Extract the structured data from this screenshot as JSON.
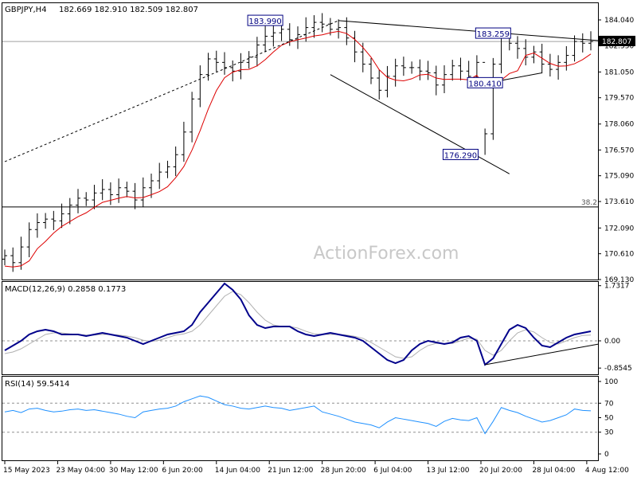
{
  "chart_data": [
    {
      "type": "candlestick",
      "panel": "price",
      "header": {
        "symbol": "GBPJPY,H4",
        "ohlc": "182.669 182.910 182.509 182.807"
      },
      "ylim": [
        169.13,
        185.0
      ],
      "y_ticks": [
        184.04,
        182.55,
        181.05,
        179.57,
        178.06,
        176.57,
        175.09,
        173.61,
        172.09,
        170.61,
        169.13
      ],
      "y_tick_labels": [
        "184.040",
        "182.550",
        "181.050",
        "179.570",
        "178.060",
        "176.570",
        "175.090",
        "173.610",
        "172.090",
        "170.610",
        "169.130"
      ],
      "current_price": {
        "value": 182.807,
        "label": "182.807"
      },
      "fib_level": {
        "value": 173.3,
        "label": "38.2"
      },
      "reference_line": 182.8,
      "annotations": [
        {
          "label": "183.990",
          "x": 32,
          "y": 183.99
        },
        {
          "label": "183.259",
          "x": 60,
          "y": 183.259
        },
        {
          "label": "180.410",
          "x": 59,
          "y": 180.41
        },
        {
          "label": "176.290",
          "x": 56,
          "y": 176.29
        }
      ],
      "trendlines": [
        {
          "x1": 0,
          "y1": 175.9,
          "x2": 41,
          "y2": 184.0,
          "style": "dashed"
        },
        {
          "x1": 41,
          "y1": 184.0,
          "x2": 73,
          "y2": 182.85,
          "style": "solid"
        },
        {
          "x1": 40,
          "y1": 180.9,
          "x2": 62,
          "y2": 175.2,
          "style": "solid"
        },
        {
          "x1": 58,
          "y1": 180.3,
          "x2": 66,
          "y2": 181.0,
          "style": "solid"
        }
      ],
      "ma_color": "#dd0000",
      "bar_color": "#000000",
      "watermark": "ActionForex.com",
      "closes": [
        170.5,
        170.1,
        171.0,
        172.0,
        172.4,
        172.6,
        172.5,
        172.9,
        173.4,
        173.8,
        173.7,
        174.1,
        174.3,
        174.0,
        174.4,
        174.2,
        173.7,
        174.4,
        174.8,
        175.3,
        175.6,
        176.3,
        177.6,
        179.5,
        180.9,
        181.8,
        181.6,
        181.3,
        181.1,
        181.6,
        181.9,
        182.6,
        183.1,
        183.3,
        183.5,
        182.9,
        183.2,
        183.6,
        183.9,
        183.8,
        183.5,
        183.6,
        183.0,
        182.2,
        181.5,
        180.7,
        180.0,
        180.8,
        181.4,
        181.3,
        181.3,
        181.1,
        181.0,
        180.3,
        180.9,
        181.4,
        181.1,
        180.8,
        181.6,
        177.5,
        181.5,
        183.0,
        182.7,
        182.4,
        181.9,
        182.2,
        181.5,
        181.2,
        181.6,
        182.0,
        182.8,
        182.7,
        182.8
      ]
    },
    {
      "type": "line",
      "panel": "macd",
      "header": "MACD(12,26,9) 0.2858 0.1773",
      "ylim": [
        -1.05,
        1.85
      ],
      "y_tick_labels": [
        "1.7317",
        "0.00",
        "-0.8545"
      ],
      "y_ticks": [
        1.7317,
        0.0,
        -0.8545
      ],
      "current_value": {
        "value": 0.0,
        "label": "0.00"
      },
      "main_color": "#00008b",
      "signal_color": "#b0b0b0",
      "main": [
        -0.3,
        -0.15,
        0.0,
        0.2,
        0.3,
        0.35,
        0.3,
        0.2,
        0.2,
        0.2,
        0.15,
        0.2,
        0.25,
        0.2,
        0.15,
        0.1,
        0.0,
        -0.1,
        0.0,
        0.1,
        0.2,
        0.25,
        0.3,
        0.5,
        0.9,
        1.2,
        1.5,
        1.8,
        1.6,
        1.3,
        0.8,
        0.5,
        0.4,
        0.45,
        0.45,
        0.45,
        0.3,
        0.2,
        0.15,
        0.2,
        0.25,
        0.2,
        0.15,
        0.1,
        0.0,
        -0.2,
        -0.4,
        -0.6,
        -0.7,
        -0.6,
        -0.3,
        -0.1,
        0.0,
        -0.05,
        -0.1,
        -0.05,
        0.1,
        0.15,
        0.0,
        -0.75,
        -0.55,
        -0.1,
        0.35,
        0.5,
        0.4,
        0.1,
        -0.15,
        -0.2,
        -0.05,
        0.1,
        0.2,
        0.25,
        0.3
      ],
      "signal": [
        -0.4,
        -0.35,
        -0.25,
        -0.1,
        0.05,
        0.2,
        0.25,
        0.25,
        0.22,
        0.2,
        0.18,
        0.18,
        0.2,
        0.2,
        0.18,
        0.15,
        0.1,
        0.02,
        -0.02,
        0.02,
        0.1,
        0.18,
        0.22,
        0.3,
        0.5,
        0.8,
        1.1,
        1.4,
        1.55,
        1.45,
        1.2,
        0.9,
        0.65,
        0.5,
        0.45,
        0.45,
        0.4,
        0.3,
        0.22,
        0.2,
        0.2,
        0.2,
        0.18,
        0.14,
        0.08,
        -0.05,
        -0.2,
        -0.35,
        -0.5,
        -0.55,
        -0.5,
        -0.3,
        -0.15,
        -0.08,
        -0.08,
        -0.08,
        0.0,
        0.08,
        0.05,
        -0.3,
        -0.45,
        -0.3,
        0.0,
        0.25,
        0.35,
        0.28,
        0.1,
        -0.05,
        -0.1,
        0.0,
        0.1,
        0.17,
        0.18
      ],
      "trendline": {
        "x1": 59,
        "y1": -0.75,
        "x2": 73,
        "y2": -0.1
      }
    },
    {
      "type": "line",
      "panel": "rsi",
      "header": "RSI(14) 59.5414",
      "ylim": [
        0,
        100
      ],
      "y_ticks": [
        100,
        70,
        50,
        30,
        0
      ],
      "y_tick_labels": [
        "100",
        "70",
        "50",
        "30",
        "0"
      ],
      "dashed_levels": [
        70,
        30
      ],
      "line_color": "#1e90ff",
      "values": [
        58,
        60,
        57,
        62,
        63,
        60,
        58,
        59,
        61,
        62,
        60,
        61,
        59,
        57,
        55,
        52,
        50,
        58,
        60,
        62,
        63,
        66,
        72,
        76,
        80,
        78,
        73,
        68,
        66,
        63,
        62,
        64,
        66,
        64,
        63,
        60,
        62,
        64,
        66,
        58,
        55,
        52,
        48,
        44,
        42,
        40,
        36,
        44,
        50,
        48,
        46,
        44,
        42,
        38,
        45,
        49,
        47,
        46,
        50,
        28,
        45,
        64,
        60,
        57,
        52,
        48,
        44,
        46,
        50,
        54,
        62,
        60,
        59.5
      ]
    }
  ],
  "x_axis": {
    "labels": [
      "15 May 2023",
      "23 May 04:00",
      "30 May 12:00",
      "6 Jun 20:00",
      "14 Jun 04:00",
      "21 Jun 12:00",
      "28 Jun 20:00",
      "6 Jul 04:00",
      "13 Jul 12:00",
      "20 Jul 20:00",
      "28 Jul 04:00",
      "4 Aug 12:00"
    ],
    "positions": [
      0,
      6.5,
      13,
      19.5,
      26,
      32.5,
      39,
      45.5,
      52,
      58.5,
      65,
      71.5
    ]
  }
}
